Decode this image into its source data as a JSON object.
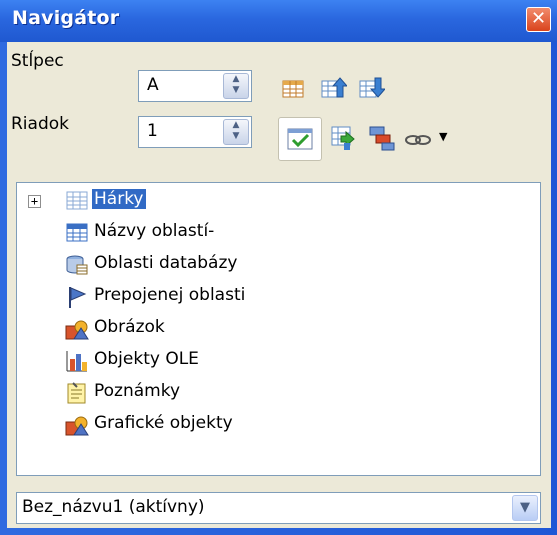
{
  "window": {
    "title": "Navigátor"
  },
  "fields": {
    "column_label": "Stĺpec",
    "column_value": "A",
    "row_label": "Riadok",
    "row_value": "1"
  },
  "tree": {
    "items": [
      {
        "label": "Hárky",
        "icon": "sheets-icon",
        "selected": true,
        "expandable": true
      },
      {
        "label": "Názvy oblastí-",
        "icon": "range-names-icon"
      },
      {
        "label": "Oblasti databázy",
        "icon": "database-icon"
      },
      {
        "label": "Prepojenej oblasti",
        "icon": "flag-icon"
      },
      {
        "label": "Obrázok",
        "icon": "image-icon"
      },
      {
        "label": "Objekty OLE",
        "icon": "ole-chart-icon"
      },
      {
        "label": "Poznámky",
        "icon": "note-icon"
      },
      {
        "label": "Grafické objekty",
        "icon": "drawing-object-icon"
      }
    ]
  },
  "document_select": {
    "value": "Bez_názvu1 (aktívny)"
  },
  "colors": {
    "title_bar": "#2a67df",
    "selection": "#316ac5",
    "panel": "#ece9d8"
  }
}
